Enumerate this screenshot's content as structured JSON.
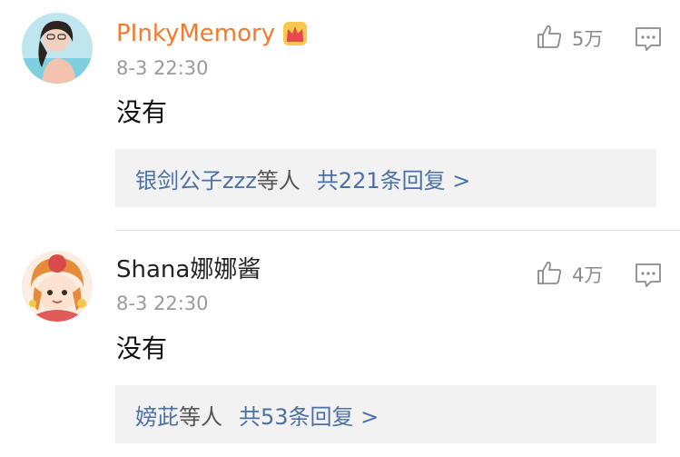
{
  "comments": [
    {
      "username": "PInkyMemory",
      "username_color": "#f07b2e",
      "badge_icon": "crown-icon",
      "timestamp": "8-3 22:30",
      "text": "没有",
      "likes": "5万",
      "reply_names": "银剑公子zzz",
      "reply_suffix": "等人",
      "reply_count": "共221条回复 >"
    },
    {
      "username": "Shana娜娜酱",
      "username_color": "#222222",
      "timestamp": "8-3 22:30",
      "text": "没有",
      "likes": "4万",
      "reply_names": "嫎茈",
      "reply_suffix": "等人",
      "reply_count": "共53条回复 >"
    }
  ],
  "colors": {
    "link_blue": "#4b70a6",
    "reply_bg": "#f2f2f2",
    "muted_gray": "#9a9a9a"
  }
}
